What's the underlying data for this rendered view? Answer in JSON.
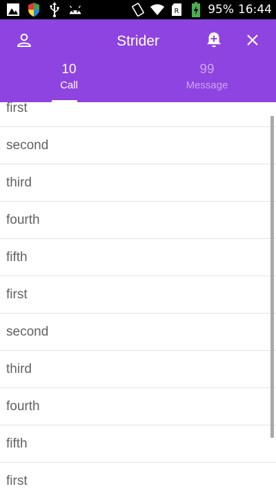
{
  "status_bar": {
    "battery_percent": "95%",
    "time": "16:44",
    "icons": [
      "image-notification-icon",
      "shield-icon",
      "usb-icon",
      "android-icon",
      "rotate-icon",
      "wifi-icon",
      "sim-icon",
      "battery-charging-icon"
    ]
  },
  "toolbar": {
    "title": "Strider",
    "icons": [
      "profile-icon",
      "bell-add-icon",
      "close-icon"
    ]
  },
  "tabs": [
    {
      "count": "10",
      "label": "Call",
      "active": true
    },
    {
      "count": "99",
      "label": "Message",
      "active": false
    }
  ],
  "list": {
    "items": [
      "first",
      "second",
      "third",
      "fourth",
      "fifth",
      "first",
      "second",
      "third",
      "fourth",
      "fifth",
      "first"
    ]
  },
  "colors": {
    "accent": "#8e44e0",
    "inactive_tab_text": "#c9a8f0",
    "list_text": "#616161",
    "divider": "#e2e2e2"
  }
}
